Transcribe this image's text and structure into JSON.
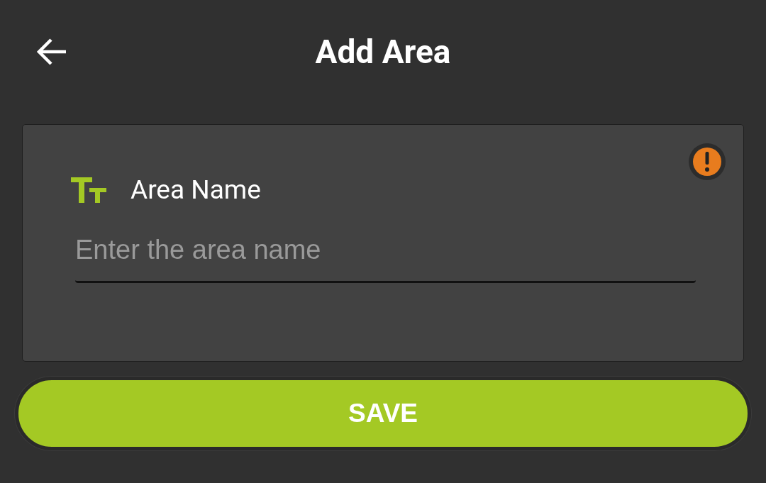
{
  "header": {
    "title": "Add Area"
  },
  "field": {
    "label": "Area Name",
    "placeholder": "Enter the area name",
    "invalid": true
  },
  "buttons": [
    {
      "label": "SAVE"
    }
  ]
}
